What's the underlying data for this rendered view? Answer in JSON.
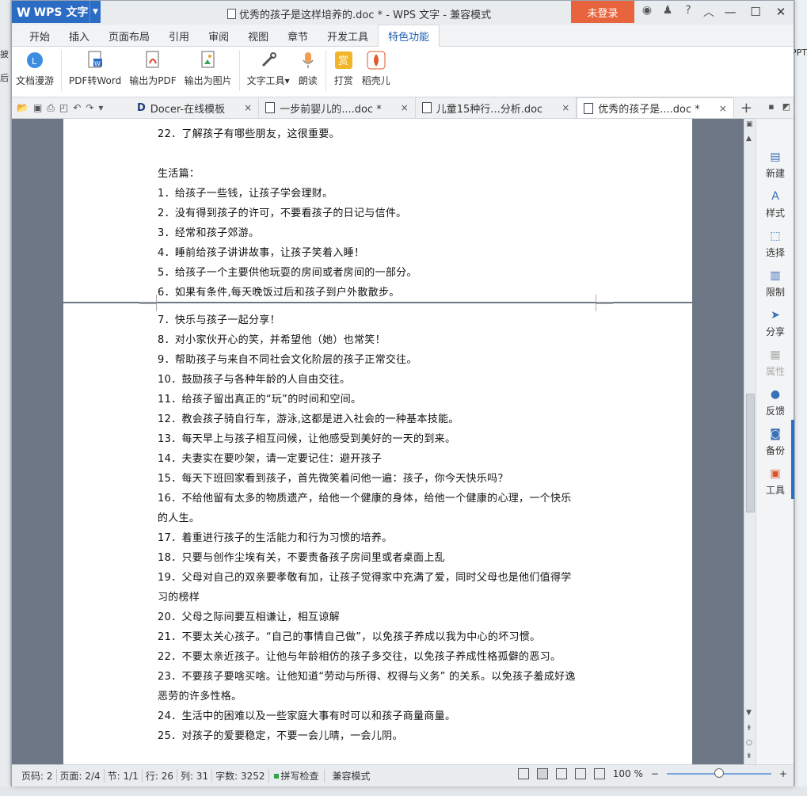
{
  "app": {
    "app_button": "WPS 文字",
    "window_title": "优秀的孩子是这样培养的.doc * - WPS 文字 - 兼容模式",
    "login_button": "未登录"
  },
  "menu_tabs": [
    "开始",
    "插入",
    "页面布局",
    "引用",
    "审阅",
    "视图",
    "章节",
    "开发工具",
    "特色功能"
  ],
  "active_menu_tab": "特色功能",
  "ribbon": [
    {
      "label": "文档漫游",
      "icon": "cloud-icon"
    },
    {
      "label": "PDF转Word",
      "icon": "pdf-to-word-icon"
    },
    {
      "label": "输出为PDF",
      "icon": "pdf-icon"
    },
    {
      "label": "输出为图片",
      "icon": "image-icon"
    },
    {
      "label": "文字工具",
      "icon": "text-tool-icon"
    },
    {
      "label": "朗读",
      "icon": "microphone-icon"
    },
    {
      "label": "打赏",
      "icon": "reward-icon"
    },
    {
      "label": "稻壳儿",
      "icon": "docer-icon"
    }
  ],
  "ribbon_caret": "▾",
  "doc_tabs": [
    {
      "label": "Docer-在线模板",
      "close": "×"
    },
    {
      "label": "一步前婴儿的....doc *",
      "close": "×"
    },
    {
      "label": "儿童15种行...分析.doc",
      "close": "×"
    },
    {
      "label": "优秀的孩子是....doc *",
      "close": "×"
    }
  ],
  "page1_lines": [
    "22．了解孩子有哪些朋友，这很重要。",
    "",
    "生活篇：",
    "1．给孩子一些钱，让孩子学会理财。",
    "2．没有得到孩子的许可，不要看孩子的日记与信件。",
    "3．经常和孩子郊游。",
    "4．睡前给孩子讲讲故事，让孩子笑着入睡！",
    "5．给孩子一个主要供他玩耍的房间或者房间的一部分。",
    "6．如果有条件,每天晚饭过后和孩子到户外散散步。"
  ],
  "page2_lines": [
    "7．快乐与孩子一起分享！",
    "8．对小家伙开心的笑，并希望他（她）也常笑！",
    "9．帮助孩子与来自不同社会文化阶层的孩子正常交往。",
    "10．鼓励孩子与各种年龄的人自由交往。",
    "11．给孩子留出真正的“玩”的时间和空间。",
    "12．教会孩子骑自行车，游泳,这都是进入社会的一种基本技能。",
    "13．每天早上与孩子相互问候，让他感受到美好的一天的到来。",
    "14．夫妻实在要吵架，请一定要记住：避开孩子",
    "15．每天下班回家看到孩子，首先微笑着问他一遍：孩子，你今天快乐吗？",
    "16．不给他留有太多的物质遗产，给他一个健康的身体，给他一个健康的心理，一个快乐",
    "的人生。",
    "17．着重进行孩子的生活能力和行为习惯的培养。",
    "18．只要与创作尘埃有关，不要责备孩子房间里或者桌面上乱",
    "19．父母对自己的双亲要孝敬有加，让孩子觉得家中充满了爱，同时父母也是他们值得学",
    "习的榜样",
    "20．父母之际间要互相谦让，相互谅解",
    "21．不要太关心孩子。“自己的事情自己做”，以免孩子养成以我为中心的坏习惯。",
    "22．不要太亲近孩子。让他与年龄相仿的孩子多交往，以免孩子养成性格孤僻的恶习。",
    "23．不要孩子要啥买啥。让他知道“劳动与所得、权得与义务” 的关系。以免孩子羞成好逸",
    "恶劳的许多性格。",
    "24．生活中的困难以及一些家庭大事有时可以和孩子商量商量。",
    "25．对孩子的爱要稳定，不要一会儿晴，一会儿阴。"
  ],
  "side_pane": [
    {
      "label": "新建",
      "icon": "new-doc-icon",
      "enabled": true
    },
    {
      "label": "样式",
      "icon": "style-icon",
      "enabled": true
    },
    {
      "label": "选择",
      "icon": "select-icon",
      "enabled": true
    },
    {
      "label": "限制",
      "icon": "restrict-icon",
      "enabled": true
    },
    {
      "label": "分享",
      "icon": "share-icon",
      "enabled": true
    },
    {
      "label": "属性",
      "icon": "properties-icon",
      "enabled": false
    },
    {
      "label": "反馈",
      "icon": "feedback-icon",
      "enabled": true
    },
    {
      "label": "备份",
      "icon": "backup-icon",
      "enabled": true
    },
    {
      "label": "工具",
      "icon": "toolbox-icon",
      "enabled": true
    }
  ],
  "status": {
    "page_num": "页码: 2",
    "pages": "页面: 2/4",
    "section": "节: 1/1",
    "row": "行: 26",
    "col": "列: 31",
    "words": "字数: 3252",
    "spell_check": "拼写检查",
    "compat": "兼容模式",
    "zoom": "100 %",
    "zoom_minus": "−",
    "zoom_plus": "+",
    "zoom_fraction": 0.5
  },
  "background": {
    "left_texts": [
      "披",
      "后"
    ],
    "right_texts": [
      "PPT"
    ]
  },
  "colors": {
    "accent": "#2b6cc4",
    "login": "#e8643c",
    "canvas": "#6d7785"
  }
}
